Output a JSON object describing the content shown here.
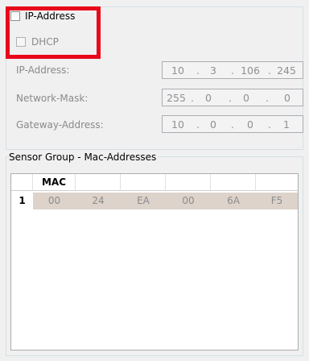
{
  "ip_settings": {
    "ip_address_checkbox_label": "IP-Address",
    "dhcp_checkbox_label": "DHCP",
    "fields": [
      {
        "label": "IP-Address:",
        "octets": [
          "10",
          "3",
          "106",
          "245"
        ]
      },
      {
        "label": "Network-Mask:",
        "octets": [
          "255",
          "0",
          "0",
          "0"
        ]
      },
      {
        "label": "Gateway-Address:",
        "octets": [
          "10",
          "0",
          "0",
          "1"
        ]
      }
    ],
    "separator": "."
  },
  "sensor_group": {
    "title": "Sensor Group - Mac-Addresses",
    "column_header": "MAC",
    "rows": [
      {
        "index": "1",
        "values": [
          "00",
          "24",
          "EA",
          "00",
          "6A",
          "F5"
        ]
      }
    ]
  },
  "colors": {
    "highlight": "#e8081b",
    "row_background": "#ddd3cb"
  }
}
